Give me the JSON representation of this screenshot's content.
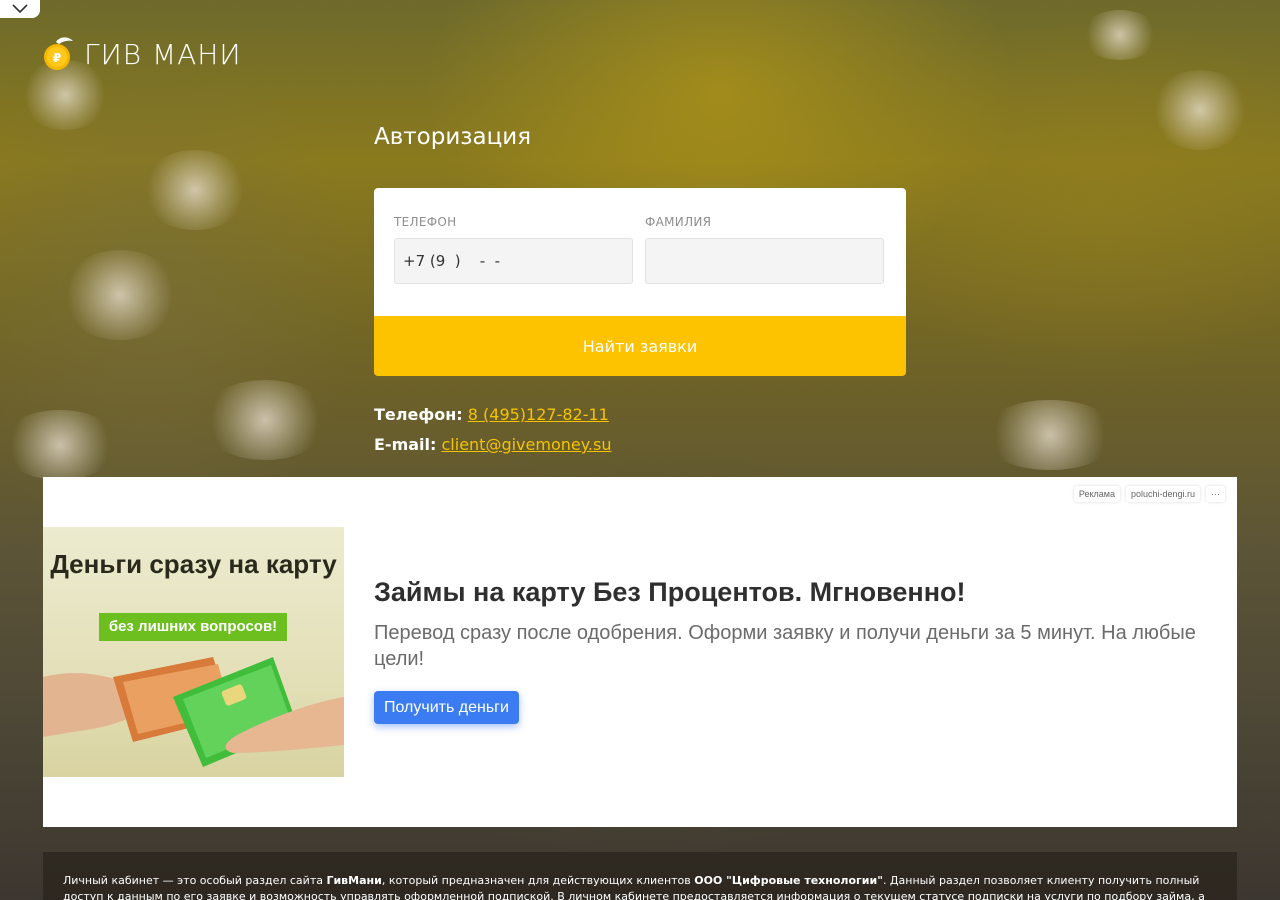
{
  "brand": {
    "name": "ГИВ МАНИ",
    "accent_color": "#fdc300",
    "coin_symbol": "₽"
  },
  "auth": {
    "title": "Авторизация",
    "phone_label": "ТЕЛЕФОН",
    "phone_value": "+7 (9  )    -  -",
    "surname_label": "ФАМИЛИЯ",
    "surname_value": "",
    "submit_label": "Найти заявки"
  },
  "contacts": {
    "phone_label": "Телефон:",
    "phone_value": "8 (495)127-82-11",
    "email_label": "E-mail:",
    "email_value": "client@givemoney.su"
  },
  "ad": {
    "tags": [
      "Реклама",
      "poluchi-dengi.ru",
      "···"
    ],
    "image_title": "Деньги сразу на карту",
    "image_subtitle": "без лишних вопросов!",
    "headline": "Займы на карту Без Процентов. Мгновенно!",
    "text": "Перевод сразу после одобрения. Оформи заявку и получи деньги за 5 минут. На любые цели!",
    "cta_label": "Получить деньги",
    "cta_color": "#3b7cf2"
  },
  "footer": {
    "text_1": "Личный кабинет — это особый раздел сайта ",
    "bold_1": "ГивМани",
    "text_2": ", который предназначен для действующих клиентов ",
    "bold_2": "ООО \"Цифровые технологии\"",
    "text_3": ". Данный раздел позволяет клиенту получить полный доступ к данным по его заявке и возможность управлять оформленной подпиской. В личном кабинете предоставляется информация о текущем статусе подписки на услуги по подбору займа, а так же о входящих и исходящих"
  }
}
